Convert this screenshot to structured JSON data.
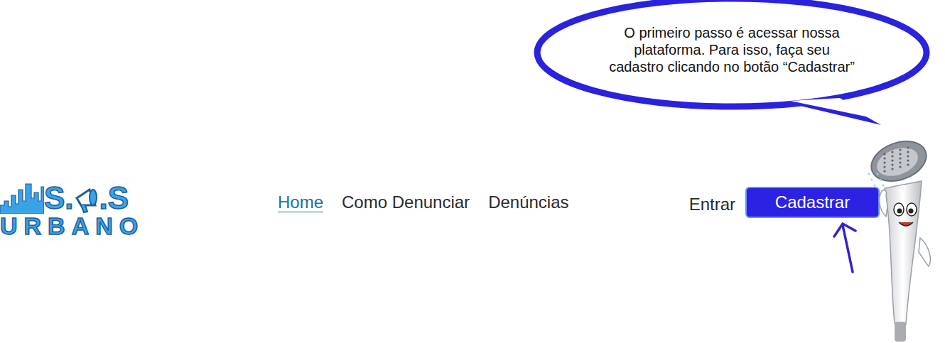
{
  "logo": {
    "top_left": "S.",
    "top_right": ".S",
    "bottom": "URBANO"
  },
  "bubble": {
    "lines": [
      "O primeiro passo é acessar nossa",
      "plataforma. Para isso, faça seu",
      "cadastro clicando no botão “Cadastrar”"
    ]
  },
  "nav": {
    "links": [
      {
        "label": "Home",
        "selected": true
      },
      {
        "label": "Como Denunciar",
        "selected": false
      },
      {
        "label": "Denúncias",
        "selected": false
      }
    ]
  },
  "auth": {
    "login": "Entrar",
    "signup": "Cadastrar"
  }
}
